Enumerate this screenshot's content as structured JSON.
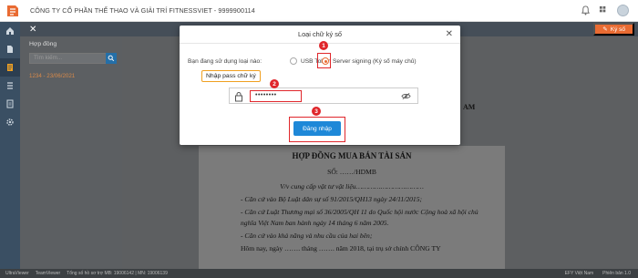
{
  "app": {
    "company": "CÔNG TY CỔ PHẦN THỂ THAO VÀ GIẢI TRÍ FITNESSVIET - 9999900114",
    "sign_button": "Ký số"
  },
  "left_panel": {
    "title": "Hợp đồng",
    "search_placeholder": "Tìm kiếm...",
    "item": "1234 - 23/06/2021"
  },
  "modal": {
    "title": "Loại chữ ký số",
    "question": "Bạn đang sử dụng loại nào:",
    "options": [
      {
        "label": "USB Token",
        "selected": false
      },
      {
        "label": "Server signing (Ký số máy chủ)",
        "selected": true
      }
    ],
    "password_value": "••••••••",
    "login_button": "Đăng nhập",
    "callout": "Nhập pass chữ ký"
  },
  "annotations": [
    "1",
    "2",
    "3"
  ],
  "document": {
    "behind_text": "AM",
    "title": "HỢP ĐỒNG MUA BÁN TÀI SẢN",
    "number": "SỐ: ……/HDMB",
    "subject": "V/v cung cấp vật tư vật liệu……………………………",
    "lines": [
      "- Căn cứ vào Bộ Luật dân sự số 91/2015/QH13 ngày 24/11/2015;",
      "- Căn cứ Luật Thương mại số 36/2005/QH 11 do Quốc hội nước Cộng hoà xã hội chủ",
      "nghĩa Việt Nam ban hành ngày 14 tháng 6 năm 2005.",
      "- Căn cứ vào khả năng và nhu cầu của hai bên;",
      "Hôm nay, ngày ……. tháng ……. năm 2018,  tại trụ sở chính  CÔNG TY"
    ]
  },
  "status_bar": {
    "items": [
      "UltraViewer",
      "TeamViewer",
      "Tổng số hồ sơ trợ MB: 19006142 | MN: 19006139"
    ],
    "right": [
      "EFY Việt Nam",
      "Phiên bản 1.0"
    ]
  },
  "colors": {
    "accent": "#e96b32",
    "primary": "#1e88d8",
    "annotation": "#e0262b",
    "callout_border": "#f0a020"
  }
}
